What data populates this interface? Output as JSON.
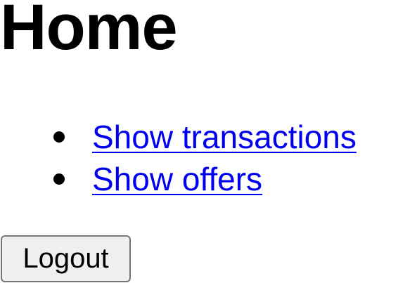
{
  "page": {
    "title": "Home"
  },
  "nav": {
    "items": [
      {
        "label": "Show transactions"
      },
      {
        "label": "Show offers"
      }
    ]
  },
  "actions": {
    "logout_label": "Logout"
  },
  "colors": {
    "link": "#0000ee",
    "button_bg": "#efefef",
    "button_border": "#767676"
  }
}
